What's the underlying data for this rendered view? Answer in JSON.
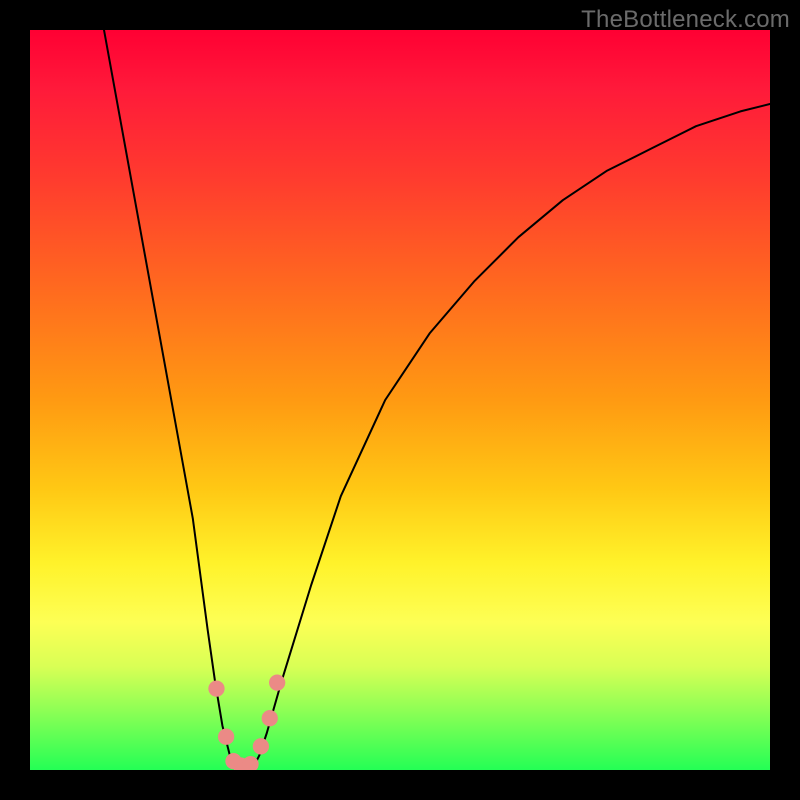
{
  "watermark": "TheBottleneck.com",
  "chart_data": {
    "type": "line",
    "title": "",
    "xlabel": "",
    "ylabel": "",
    "xlim": [
      0,
      100
    ],
    "ylim": [
      0,
      100
    ],
    "grid": false,
    "legend": false,
    "background_gradient": {
      "orientation": "vertical",
      "stops": [
        {
          "pos": 0.0,
          "color": "#ff0033"
        },
        {
          "pos": 0.5,
          "color": "#ff9a12"
        },
        {
          "pos": 0.75,
          "color": "#fff22a"
        },
        {
          "pos": 1.0,
          "color": "#24ff55"
        }
      ]
    },
    "series": [
      {
        "name": "bottleneck-curve",
        "color": "#000000",
        "x": [
          10,
          12,
          14,
          16,
          18,
          20,
          22,
          24,
          25,
          26,
          27,
          28,
          29,
          30,
          31,
          32,
          34,
          38,
          42,
          48,
          54,
          60,
          66,
          72,
          78,
          84,
          90,
          96,
          100
        ],
        "y": [
          100,
          89,
          78,
          67,
          56,
          45,
          34,
          19,
          12,
          6,
          2,
          0,
          0,
          0,
          2,
          5,
          12,
          25,
          37,
          50,
          59,
          66,
          72,
          77,
          81,
          84,
          87,
          89,
          90
        ]
      }
    ],
    "markers": [
      {
        "name": "marker-1",
        "x": 25.2,
        "y": 11.0,
        "r": 1.1,
        "color": "#eb8a86"
      },
      {
        "name": "marker-2",
        "x": 26.5,
        "y": 4.5,
        "r": 1.1,
        "color": "#eb8a86"
      },
      {
        "name": "marker-3",
        "x": 27.5,
        "y": 1.2,
        "r": 1.1,
        "color": "#eb8a86"
      },
      {
        "name": "marker-4",
        "x": 28.5,
        "y": 0.6,
        "r": 1.1,
        "color": "#eb8a86"
      },
      {
        "name": "marker-5",
        "x": 29.8,
        "y": 0.8,
        "r": 1.1,
        "color": "#eb8a86"
      },
      {
        "name": "marker-6",
        "x": 31.2,
        "y": 3.2,
        "r": 1.1,
        "color": "#eb8a86"
      },
      {
        "name": "marker-7",
        "x": 32.4,
        "y": 7.0,
        "r": 1.1,
        "color": "#eb8a86"
      },
      {
        "name": "marker-8",
        "x": 33.4,
        "y": 11.8,
        "r": 1.1,
        "color": "#eb8a86"
      }
    ]
  }
}
